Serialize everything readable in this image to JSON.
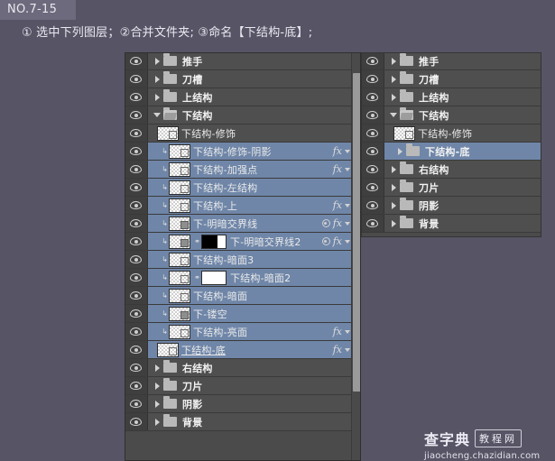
{
  "header": {
    "badge": "NO.7-15",
    "instruction": "① 选中下列图层；②合并文件夹; ③命名【下结构-底】;"
  },
  "left_panel": {
    "name": "photoshop-layers-panel-before",
    "scroll_thumb_top_pct": 5,
    "scroll_thumb_height_pct": 78,
    "rows": [
      {
        "name": "推手",
        "type": "group",
        "indent": 0,
        "arrow": "right",
        "selected": false,
        "fx": false,
        "caret": false
      },
      {
        "name": "刀槽",
        "type": "group",
        "indent": 0,
        "arrow": "right",
        "selected": false,
        "fx": false,
        "caret": false
      },
      {
        "name": "上结构",
        "type": "group",
        "indent": 0,
        "arrow": "right",
        "selected": false,
        "fx": false,
        "caret": false
      },
      {
        "name": "下结构",
        "type": "group",
        "indent": 0,
        "arrow": "down",
        "selected": false,
        "fx": false,
        "caret": false,
        "open": true
      },
      {
        "name": "下结构-修饰",
        "type": "layer",
        "indent": 1,
        "selected": false,
        "fx": false,
        "caret": false,
        "clip": false
      },
      {
        "name": "下结构-修饰-阴影",
        "type": "layer",
        "indent": 2,
        "selected": true,
        "fx": true,
        "caret": true,
        "clip": true
      },
      {
        "name": "下结构-加强点",
        "type": "layer",
        "indent": 2,
        "selected": true,
        "fx": true,
        "caret": true,
        "clip": true
      },
      {
        "name": "下结构-左结构",
        "type": "layer",
        "indent": 2,
        "selected": true,
        "fx": false,
        "caret": false,
        "clip": true
      },
      {
        "name": "下结构-上",
        "type": "layer",
        "indent": 2,
        "selected": true,
        "fx": true,
        "caret": true,
        "clip": true
      },
      {
        "name": "下-明暗交界线",
        "type": "layer",
        "indent": 2,
        "selected": true,
        "fx": true,
        "caret": true,
        "clip": true,
        "eyedot": true
      },
      {
        "name": "下-明暗交界线2",
        "type": "layer",
        "indent": 2,
        "selected": true,
        "fx": true,
        "caret": true,
        "clip": true,
        "eyedot": true,
        "mask": "bw",
        "chain": true
      },
      {
        "name": "下结构-暗面3",
        "type": "layer",
        "indent": 2,
        "selected": true,
        "fx": false,
        "caret": false,
        "clip": true
      },
      {
        "name": "下结构-暗面2",
        "type": "layer",
        "indent": 2,
        "selected": true,
        "fx": false,
        "caret": false,
        "clip": true,
        "mask": "white",
        "chain": true
      },
      {
        "name": "下结构-暗面",
        "type": "layer",
        "indent": 2,
        "selected": true,
        "fx": false,
        "caret": false,
        "clip": true
      },
      {
        "name": "下-镂空",
        "type": "layer",
        "indent": 2,
        "selected": true,
        "fx": false,
        "caret": false,
        "clip": true
      },
      {
        "name": "下结构-亮面",
        "type": "layer",
        "indent": 2,
        "selected": true,
        "fx": true,
        "caret": true,
        "clip": true
      },
      {
        "name": "下结构-底",
        "type": "layer",
        "indent": 1,
        "selected": true,
        "fx": true,
        "caret": true,
        "clip": false,
        "renaming": true
      },
      {
        "name": "右结构",
        "type": "group",
        "indent": 0,
        "arrow": "right",
        "selected": false,
        "fx": false,
        "caret": false
      },
      {
        "name": "刀片",
        "type": "group",
        "indent": 0,
        "arrow": "right",
        "selected": false,
        "fx": false,
        "caret": false
      },
      {
        "name": "阴影",
        "type": "group",
        "indent": 0,
        "arrow": "right",
        "selected": false,
        "fx": false,
        "caret": false
      },
      {
        "name": "背景",
        "type": "group",
        "indent": 0,
        "arrow": "right",
        "selected": false,
        "fx": false,
        "caret": false
      }
    ]
  },
  "right_panel": {
    "name": "photoshop-layers-panel-after",
    "rows": [
      {
        "name": "推手",
        "type": "group",
        "indent": 0,
        "arrow": "right",
        "selected": false
      },
      {
        "name": "刀槽",
        "type": "group",
        "indent": 0,
        "arrow": "right",
        "selected": false
      },
      {
        "name": "上结构",
        "type": "group",
        "indent": 0,
        "arrow": "right",
        "selected": false
      },
      {
        "name": "下结构",
        "type": "group",
        "indent": 0,
        "arrow": "down",
        "selected": false,
        "open": true
      },
      {
        "name": "下结构-修饰",
        "type": "layer",
        "indent": 1,
        "selected": false
      },
      {
        "name": "下结构-底",
        "type": "group",
        "indent": 1,
        "arrow": "right",
        "selected": true
      },
      {
        "name": "右结构",
        "type": "group",
        "indent": 0,
        "arrow": "right",
        "selected": false
      },
      {
        "name": "刀片",
        "type": "group",
        "indent": 0,
        "arrow": "right",
        "selected": false
      },
      {
        "name": "阴影",
        "type": "group",
        "indent": 0,
        "arrow": "right",
        "selected": false
      },
      {
        "name": "背景",
        "type": "group",
        "indent": 0,
        "arrow": "right",
        "selected": false
      }
    ]
  },
  "watermark": {
    "main": "查字典",
    "boxed": "教程网",
    "url": "jiaocheng.chazidian.com"
  },
  "colors": {
    "page_bg": "#575466",
    "panel_bg": "#4f4f4f",
    "row_divider": "#3a3a3a",
    "selection": "#6f86a8",
    "text": "#eaeaea",
    "eye_cell": "#3f3f3f"
  }
}
